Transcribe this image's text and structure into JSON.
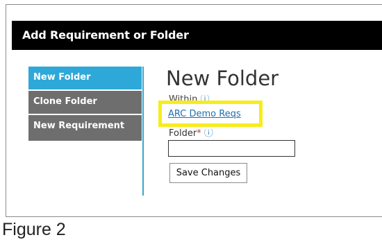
{
  "dialog": {
    "title": "Add Requirement or Folder"
  },
  "sidebar": {
    "items": [
      {
        "label": "New Folder",
        "active": true
      },
      {
        "label": "Clone Folder",
        "active": false
      },
      {
        "label": "New Requirement",
        "active": false
      }
    ]
  },
  "form": {
    "heading": "New Folder",
    "within_label": "Within",
    "within_value": "ARC Demo Reqs",
    "folder_label": "Folder",
    "folder_required_mark": "*",
    "info_glyph": "ⓘ",
    "folder_value": "",
    "save_label": "Save Changes"
  },
  "caption": "Figure 2",
  "colors": {
    "title_bg": "#000000",
    "nav_active": "#2ea8d8",
    "nav_inactive": "#6e6e6e",
    "highlight": "#f7ec1b",
    "link": "#1d6fb0"
  }
}
